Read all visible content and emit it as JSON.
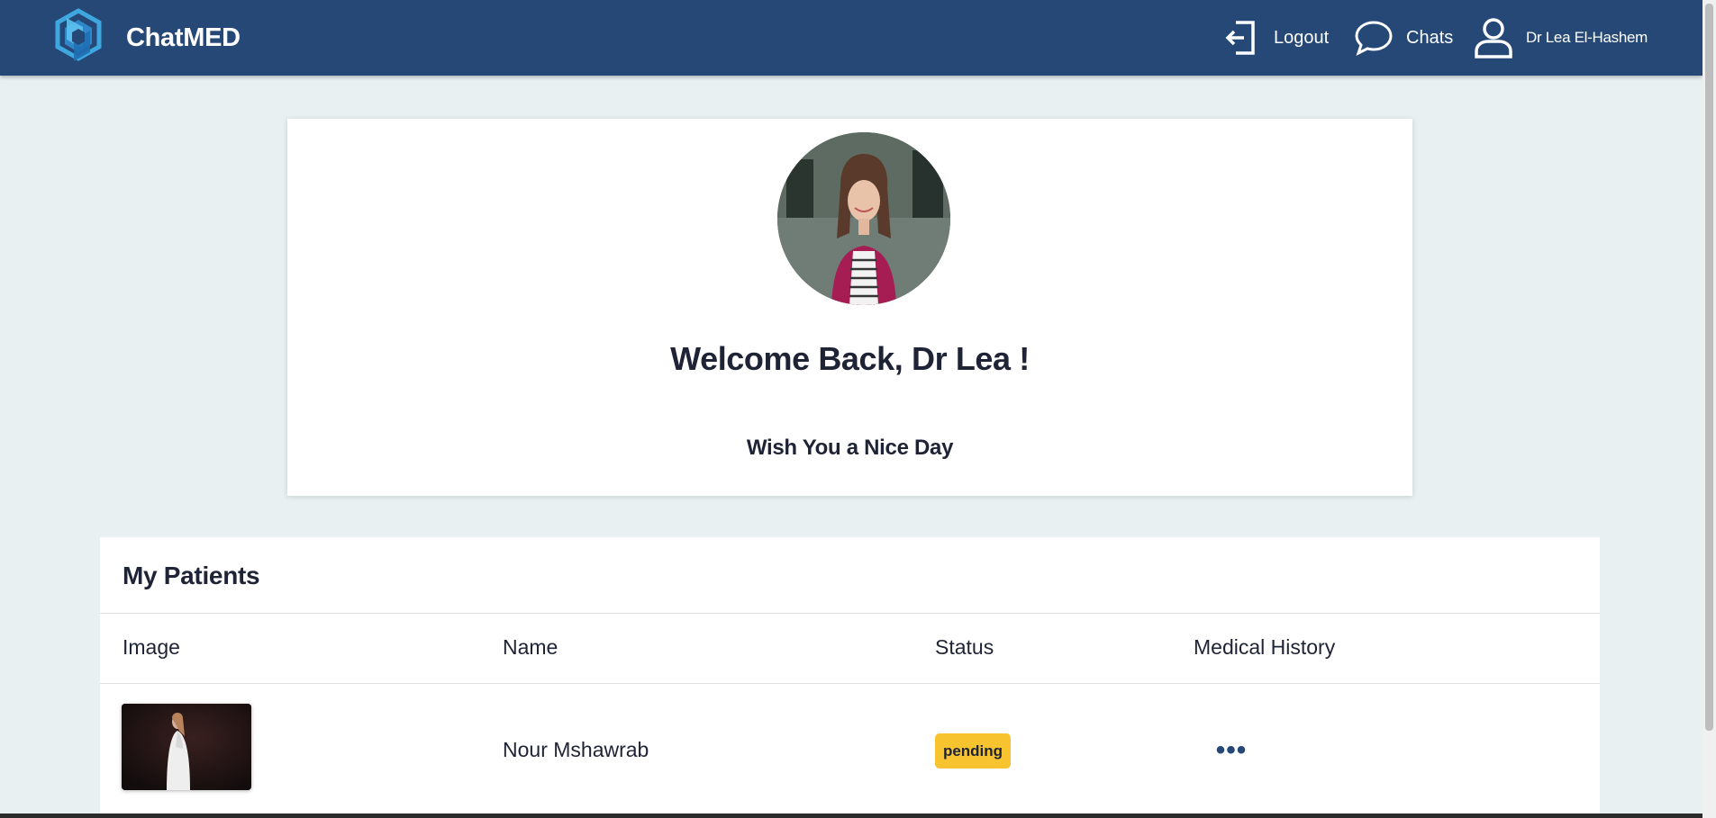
{
  "app": {
    "name": "ChatMED"
  },
  "nav": {
    "logout_label": "Logout",
    "chats_label": "Chats",
    "user_label": "Dr Lea El-Hashem",
    "icons": {
      "logo": "chatmed-logo-icon",
      "logout": "logout-icon",
      "chats": "chat-bubble-icon",
      "user": "user-icon"
    }
  },
  "welcome": {
    "title": "Welcome Back, Dr Lea !",
    "subtitle": "Wish You a Nice Day"
  },
  "patients": {
    "title": "My Patients",
    "columns": [
      "Image",
      "Name",
      "Status",
      "Medical History"
    ],
    "rows": [
      {
        "name": "Nour Mshawrab",
        "status": "pending",
        "history_action": "•••"
      }
    ]
  },
  "colors": {
    "navbar": "#254876",
    "background": "#e8f0f2",
    "status_pending": "#f7c32e",
    "text_dark": "#1e2436"
  }
}
